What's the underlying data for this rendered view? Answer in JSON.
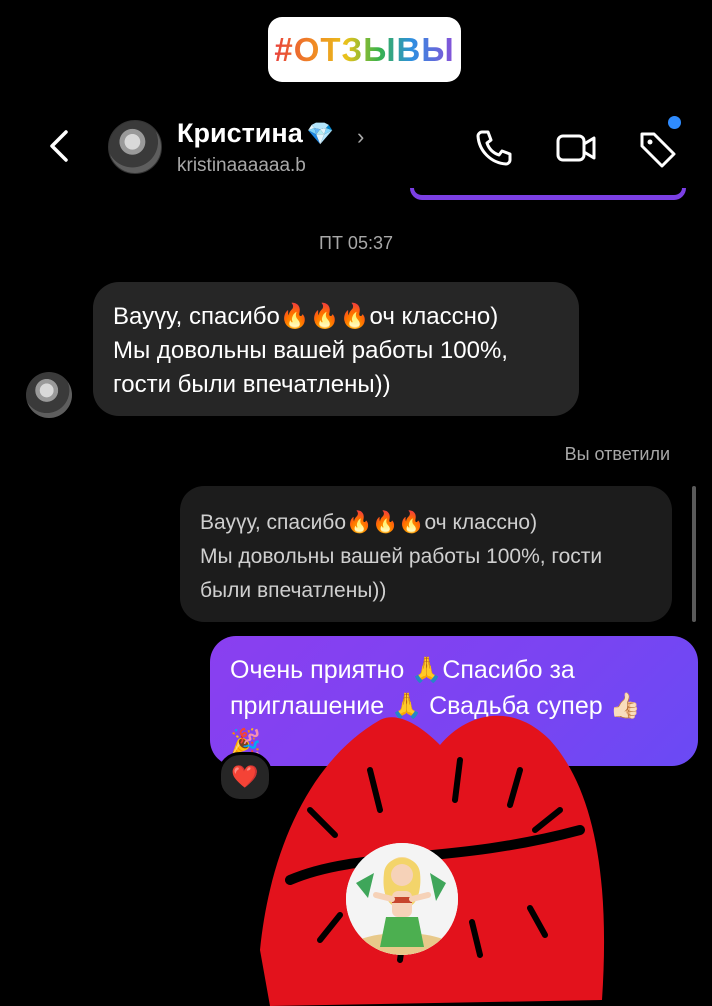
{
  "hashtag": "#ОТЗЫВЫ",
  "header": {
    "name": "Кристина",
    "name_badge": "💎",
    "username": "kristinaaaaaa.b"
  },
  "messages": {
    "timestamp": "ПТ 05:37",
    "incoming": {
      "line1_prefix": "Вауүу, спасибо",
      "fire": "🔥🔥🔥",
      "line1_suffix": "оч классно)",
      "line2": "Мы довольны вашей работы 100%,",
      "line3": "гости были впечатлены))"
    },
    "reply_label": "Вы ответили",
    "quoted": {
      "line1_prefix": "Вауүу, спасибо",
      "fire": "🔥🔥🔥",
      "line1_suffix": "оч классно)",
      "line2": "Мы довольны вашей работы 100%, гости",
      "line3": "были впечатлены))"
    },
    "outgoing": {
      "line1": "Очень приятно 🙏Спасибо за",
      "line2": "приглашение 🙏 Свадьба супер 👍🏻",
      "line3": "🎉"
    },
    "reaction": "❤️"
  },
  "colors": {
    "outgoing_bubble": "#7a44f2",
    "incoming_bubble": "#262626",
    "kiss_overlay": "#e3121c",
    "unread_dot": "#2f8cff"
  }
}
